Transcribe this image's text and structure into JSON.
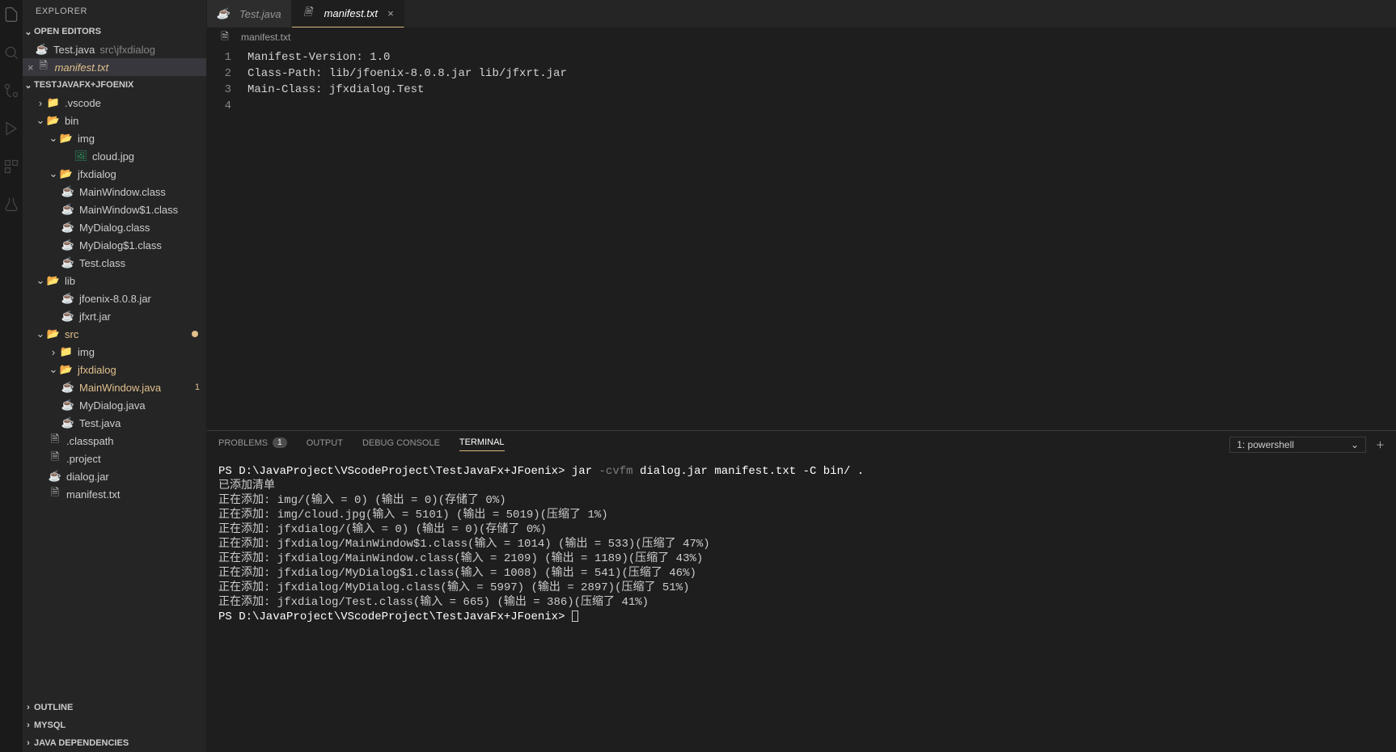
{
  "sidebar": {
    "title": "EXPLORER",
    "sections": {
      "openEditors": {
        "label": "OPEN EDITORS",
        "items": [
          {
            "name": "Test.java",
            "path": "src\\jfxdialog"
          },
          {
            "name": "manifest.txt",
            "modified": true
          }
        ]
      },
      "workspace": {
        "label": "TESTJAVAFX+JFOENIX"
      },
      "outline": {
        "label": "OUTLINE"
      },
      "mysql": {
        "label": "MYSQL"
      },
      "javaDeps": {
        "label": "JAVA DEPENDENCIES"
      }
    },
    "tree": {
      "vscode": ".vscode",
      "bin": "bin",
      "img": "img",
      "cloud": "cloud.jpg",
      "jfxdialog": "jfxdialog",
      "mainwindow_class": "MainWindow.class",
      "mainwindow1_class": "MainWindow$1.class",
      "mydialog_class": "MyDialog.class",
      "mydialog1_class": "MyDialog$1.class",
      "test_class": "Test.class",
      "lib": "lib",
      "jfoenix_jar": "jfoenix-8.0.8.jar",
      "jfxrt_jar": "jfxrt.jar",
      "src": "src",
      "src_img": "img",
      "src_jfxdialog": "jfxdialog",
      "mainwindow_java": "MainWindow.java",
      "mainwindow_java_badge": "1",
      "mydialog_java": "MyDialog.java",
      "test_java": "Test.java",
      "classpath": ".classpath",
      "project": ".project",
      "dialog_jar": "dialog.jar",
      "manifest_txt": "manifest.txt"
    }
  },
  "tabs": [
    {
      "label": "Test.java",
      "active": false
    },
    {
      "label": "manifest.txt",
      "active": true
    }
  ],
  "breadcrumb": "manifest.txt",
  "editor": {
    "lines": [
      "Manifest-Version: 1.0",
      "Class-Path: lib/jfoenix-8.0.8.jar lib/jfxrt.jar",
      "Main-Class: jfxdialog.Test",
      ""
    ]
  },
  "panel": {
    "tabs": {
      "problems": "PROBLEMS",
      "problemsCount": "1",
      "output": "OUTPUT",
      "debug": "DEBUG CONSOLE",
      "terminal": "TERMINAL"
    },
    "selector": "1: powershell"
  },
  "terminal": {
    "prompt1": "PS D:\\JavaProject\\VScodeProject\\TestJavaFx+JFoenix>",
    "cmd": "jar",
    "flags": "-cvfm",
    "args": "dialog.jar manifest.txt -C bin/ .",
    "lines": [
      "已添加清单",
      "正在添加: img/(输入 = 0) (输出 = 0)(存储了 0%)",
      "正在添加: img/cloud.jpg(输入 = 5101) (输出 = 5019)(压缩了 1%)",
      "正在添加: jfxdialog/(输入 = 0) (输出 = 0)(存储了 0%)",
      "正在添加: jfxdialog/MainWindow$1.class(输入 = 1014) (输出 = 533)(压缩了 47%)",
      "正在添加: jfxdialog/MainWindow.class(输入 = 2109) (输出 = 1189)(压缩了 43%)",
      "正在添加: jfxdialog/MyDialog$1.class(输入 = 1008) (输出 = 541)(压缩了 46%)",
      "正在添加: jfxdialog/MyDialog.class(输入 = 5997) (输出 = 2897)(压缩了 51%)",
      "正在添加: jfxdialog/Test.class(输入 = 665) (输出 = 386)(压缩了 41%)"
    ],
    "prompt2": "PS D:\\JavaProject\\VScodeProject\\TestJavaFx+JFoenix>"
  }
}
